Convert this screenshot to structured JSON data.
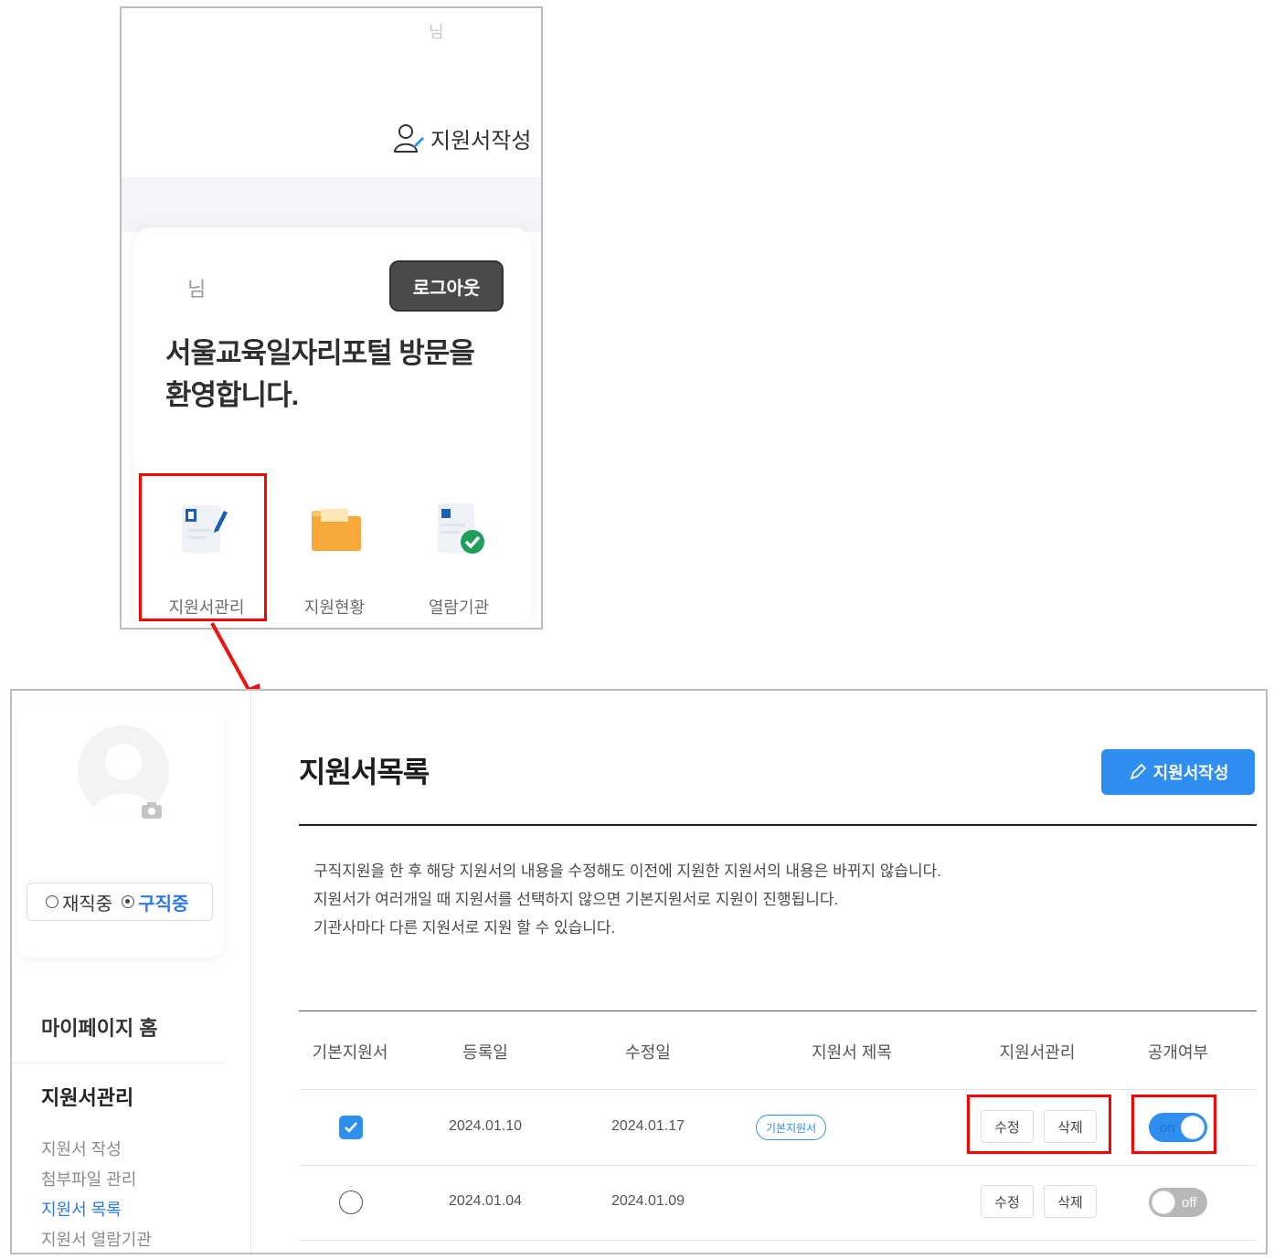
{
  "mobile": {
    "greeting_top": "님",
    "write_link_label": "지원서작성",
    "user_name": "님",
    "logout_label": "로그아웃",
    "welcome_line1": "서울교육일자리포털 방문을",
    "welcome_line2": "환영합니다.",
    "menu": [
      {
        "label": "지원서관리",
        "icon": "form-edit-icon"
      },
      {
        "label": "지원현황",
        "icon": "folder-icon"
      },
      {
        "label": "열람기관",
        "icon": "document-check-icon"
      }
    ]
  },
  "desktop": {
    "sidebar": {
      "status_options": [
        {
          "label": "재직중",
          "selected": false
        },
        {
          "label": "구직중",
          "selected": true
        }
      ],
      "nav_home": "마이페이지 홈",
      "nav_manage": "지원서관리",
      "sub_items": [
        {
          "label": "지원서 작성",
          "active": false
        },
        {
          "label": "첨부파일 관리",
          "active": false
        },
        {
          "label": "지원서 목록",
          "active": true
        },
        {
          "label": "지원서 열람기관",
          "active": false
        }
      ]
    },
    "page_title": "지원서목록",
    "write_button": "지원서작성",
    "notes": [
      "구직지원을 한 후 해당 지원서의 내용을 수정해도 이전에 지원한 지원서의 내용은 바뀌지 않습니다.",
      "지원서가 여러개일 때 지원서를 선택하지 않으면 기본지원서로 지원이 진행됩니다.",
      "기관사마다 다른 지원서로 지원 할 수 있습니다."
    ],
    "table": {
      "headers": [
        "기본지원서",
        "등록일",
        "수정일",
        "지원서 제목",
        "지원서관리",
        "공개여부"
      ],
      "rows": [
        {
          "is_default": true,
          "registered": "2024.01.10",
          "modified": "2024.01.17",
          "badge": "기본지원서",
          "title": "",
          "edit": "수정",
          "delete": "삭제",
          "public": true,
          "toggle_label": "on"
        },
        {
          "is_default": false,
          "registered": "2024.01.04",
          "modified": "2024.01.09",
          "badge": "",
          "title": "",
          "edit": "수정",
          "delete": "삭제",
          "public": false,
          "toggle_label": "off"
        }
      ]
    }
  },
  "colors": {
    "accent": "#2e8ff0",
    "highlight": "#ff0000",
    "logout_bg": "#4a4a4a"
  }
}
